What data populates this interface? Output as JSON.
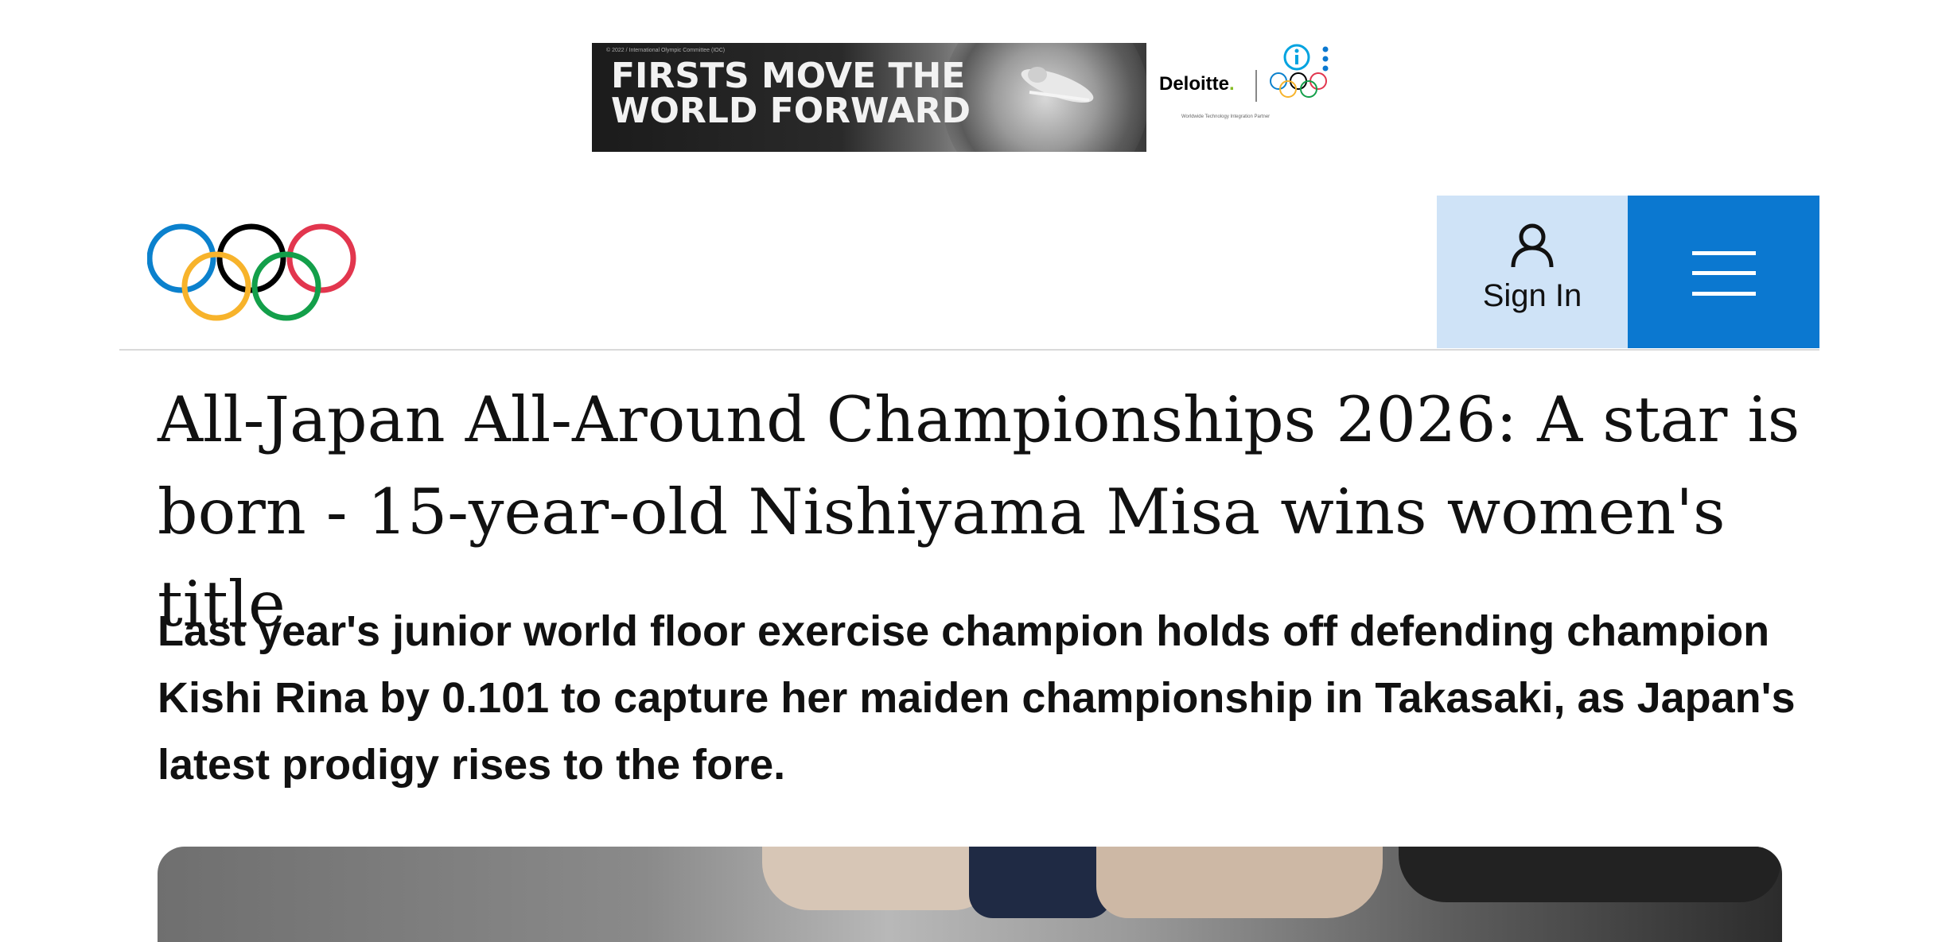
{
  "ad": {
    "fine_print": "© 2022 / International Olympic Committee (IOC)",
    "headline_line1": "FIRSTS MOVE THE",
    "headline_line2": "WORLD FORWARD",
    "brand": "Deloitte",
    "brand_dot": ".",
    "subline": "Worldwide Technology Integration Partner",
    "info_icon": "info-icon",
    "menu_icon": "more-vertical-icon"
  },
  "header": {
    "logo": "olympic-rings-logo",
    "sign_in_label": "Sign In",
    "menu_icon": "hamburger-menu-icon"
  },
  "article": {
    "headline": "All-Japan All-Around Championships 2026: A star is born - 15-year-old Nishiyama Misa wins women's title",
    "standfirst": "Last year's junior world floor exercise champion holds off defending champion Kishi Rina by 0.101 to capture her maiden championship in Takasaki, as Japan's latest prodigy rises to the fore."
  },
  "colors": {
    "ring_blue": "#0b81cd",
    "ring_yellow": "#f7b32b",
    "ring_black": "#000000",
    "ring_green": "#139f4a",
    "ring_red": "#e2364e",
    "signin_bg": "#cfe3f7",
    "menu_bg": "#0b78d0"
  }
}
